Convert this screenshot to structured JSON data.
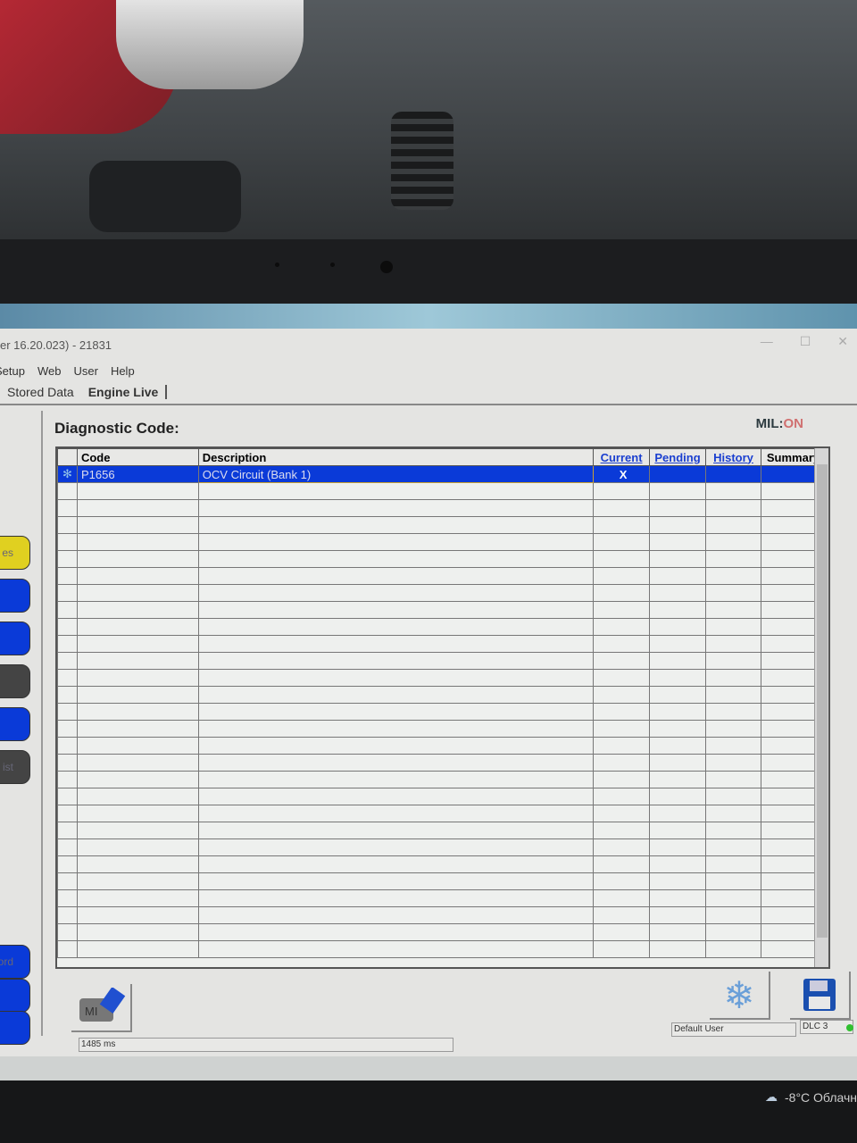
{
  "window": {
    "title": "er 16.20.023) - 21831",
    "controls": [
      "—",
      "☐",
      "✕"
    ]
  },
  "menu": [
    "Setup",
    "Web",
    "User",
    "Help"
  ],
  "tabs": [
    {
      "label": "Stored Data",
      "active": false
    },
    {
      "label": "Engine Live",
      "active": true
    }
  ],
  "left_buttons": [
    {
      "label": "es",
      "color": "#e0d020"
    },
    {
      "label": "",
      "color": "#0a3ad8"
    },
    {
      "label": "",
      "color": "#0a3ad8"
    },
    {
      "label": "",
      "color": "#444444"
    },
    {
      "label": "",
      "color": "#0a3ad8"
    },
    {
      "label": "ist",
      "color": "#444444"
    },
    {
      "label": "ord",
      "color": "#0a3ad8"
    },
    {
      "label": "",
      "color": "#0a3ad8"
    },
    {
      "label": "",
      "color": "#0a3ad8"
    }
  ],
  "main": {
    "title": "Diagnostic Code:",
    "mil_label": "MIL:",
    "mil_value": "ON",
    "mil_color": "#d07070",
    "columns": [
      "",
      "Code",
      "Description",
      "Current",
      "Pending",
      "History",
      "Summary"
    ],
    "rows": [
      {
        "icon": "freeze-frame-icon",
        "code": "P1656",
        "description": "OCV Circuit (Bank 1)",
        "current": "X",
        "pending": "",
        "history": "",
        "summary": "",
        "selected": true
      }
    ]
  },
  "statusbar": {
    "timing": "1485 ms",
    "user": "Default User",
    "connection": "DLC 3",
    "connection_color": "#30c030"
  },
  "icons": {
    "mil_reset": "engine-mil-eraser-icon",
    "freeze": "snowflake-icon",
    "save": "floppy-disk-icon"
  },
  "taskbar": {
    "weather": "-8°C Облачн"
  },
  "colors": {
    "selection": "#0a3ad8",
    "link": "#1a3fd0"
  }
}
